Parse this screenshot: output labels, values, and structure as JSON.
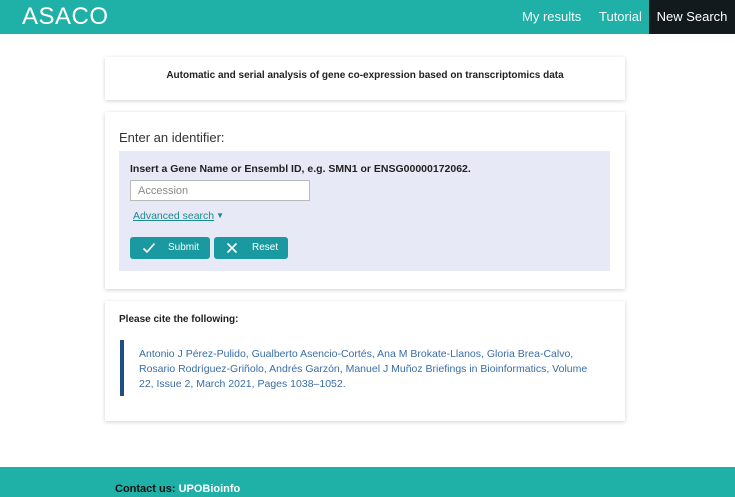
{
  "nav": {
    "brand": "ASACO",
    "links": [
      "My results",
      "Tutorial",
      "New Search"
    ]
  },
  "header": {
    "subtitle": "Automatic and serial analysis of gene co-expression based on transcriptomics data"
  },
  "form": {
    "enter_label": "Enter an identifier:",
    "instruction": "Insert a Gene Name or Ensembl ID, e.g. SMN1 or ENSG00000172062.",
    "input_placeholder": "Accession",
    "input_value": "",
    "advanced_search": "Advanced search",
    "submit_label": "Submit",
    "reset_label": "Reset"
  },
  "cite": {
    "heading": "Please cite the following:",
    "citation": "Antonio J Pérez-Pulido, Gualberto Asencio-Cortés, Ana M Brokate-Llanos, Gloria Brea-Calvo, Rosario Rodríguez-Griñolo, Andrés Garzón, Manuel J Muñoz Briefings in Bioinformatics, Volume 22, Issue 2, March 2021, Pages 1038–1052."
  },
  "footer": {
    "contact_label": "Contact us:",
    "contact_link": "UPOBioinfo"
  },
  "colors": {
    "primary": "#1fb0a8",
    "button": "#1a9aa0",
    "active_nav": "#121a1e",
    "panel": "#e8e9f6",
    "citation_border": "#1d4f86",
    "citation_text": "#3a6da6"
  },
  "icons": {
    "submit": "check-icon",
    "reset": "close-icon",
    "advanced": "chevron-down-icon"
  }
}
